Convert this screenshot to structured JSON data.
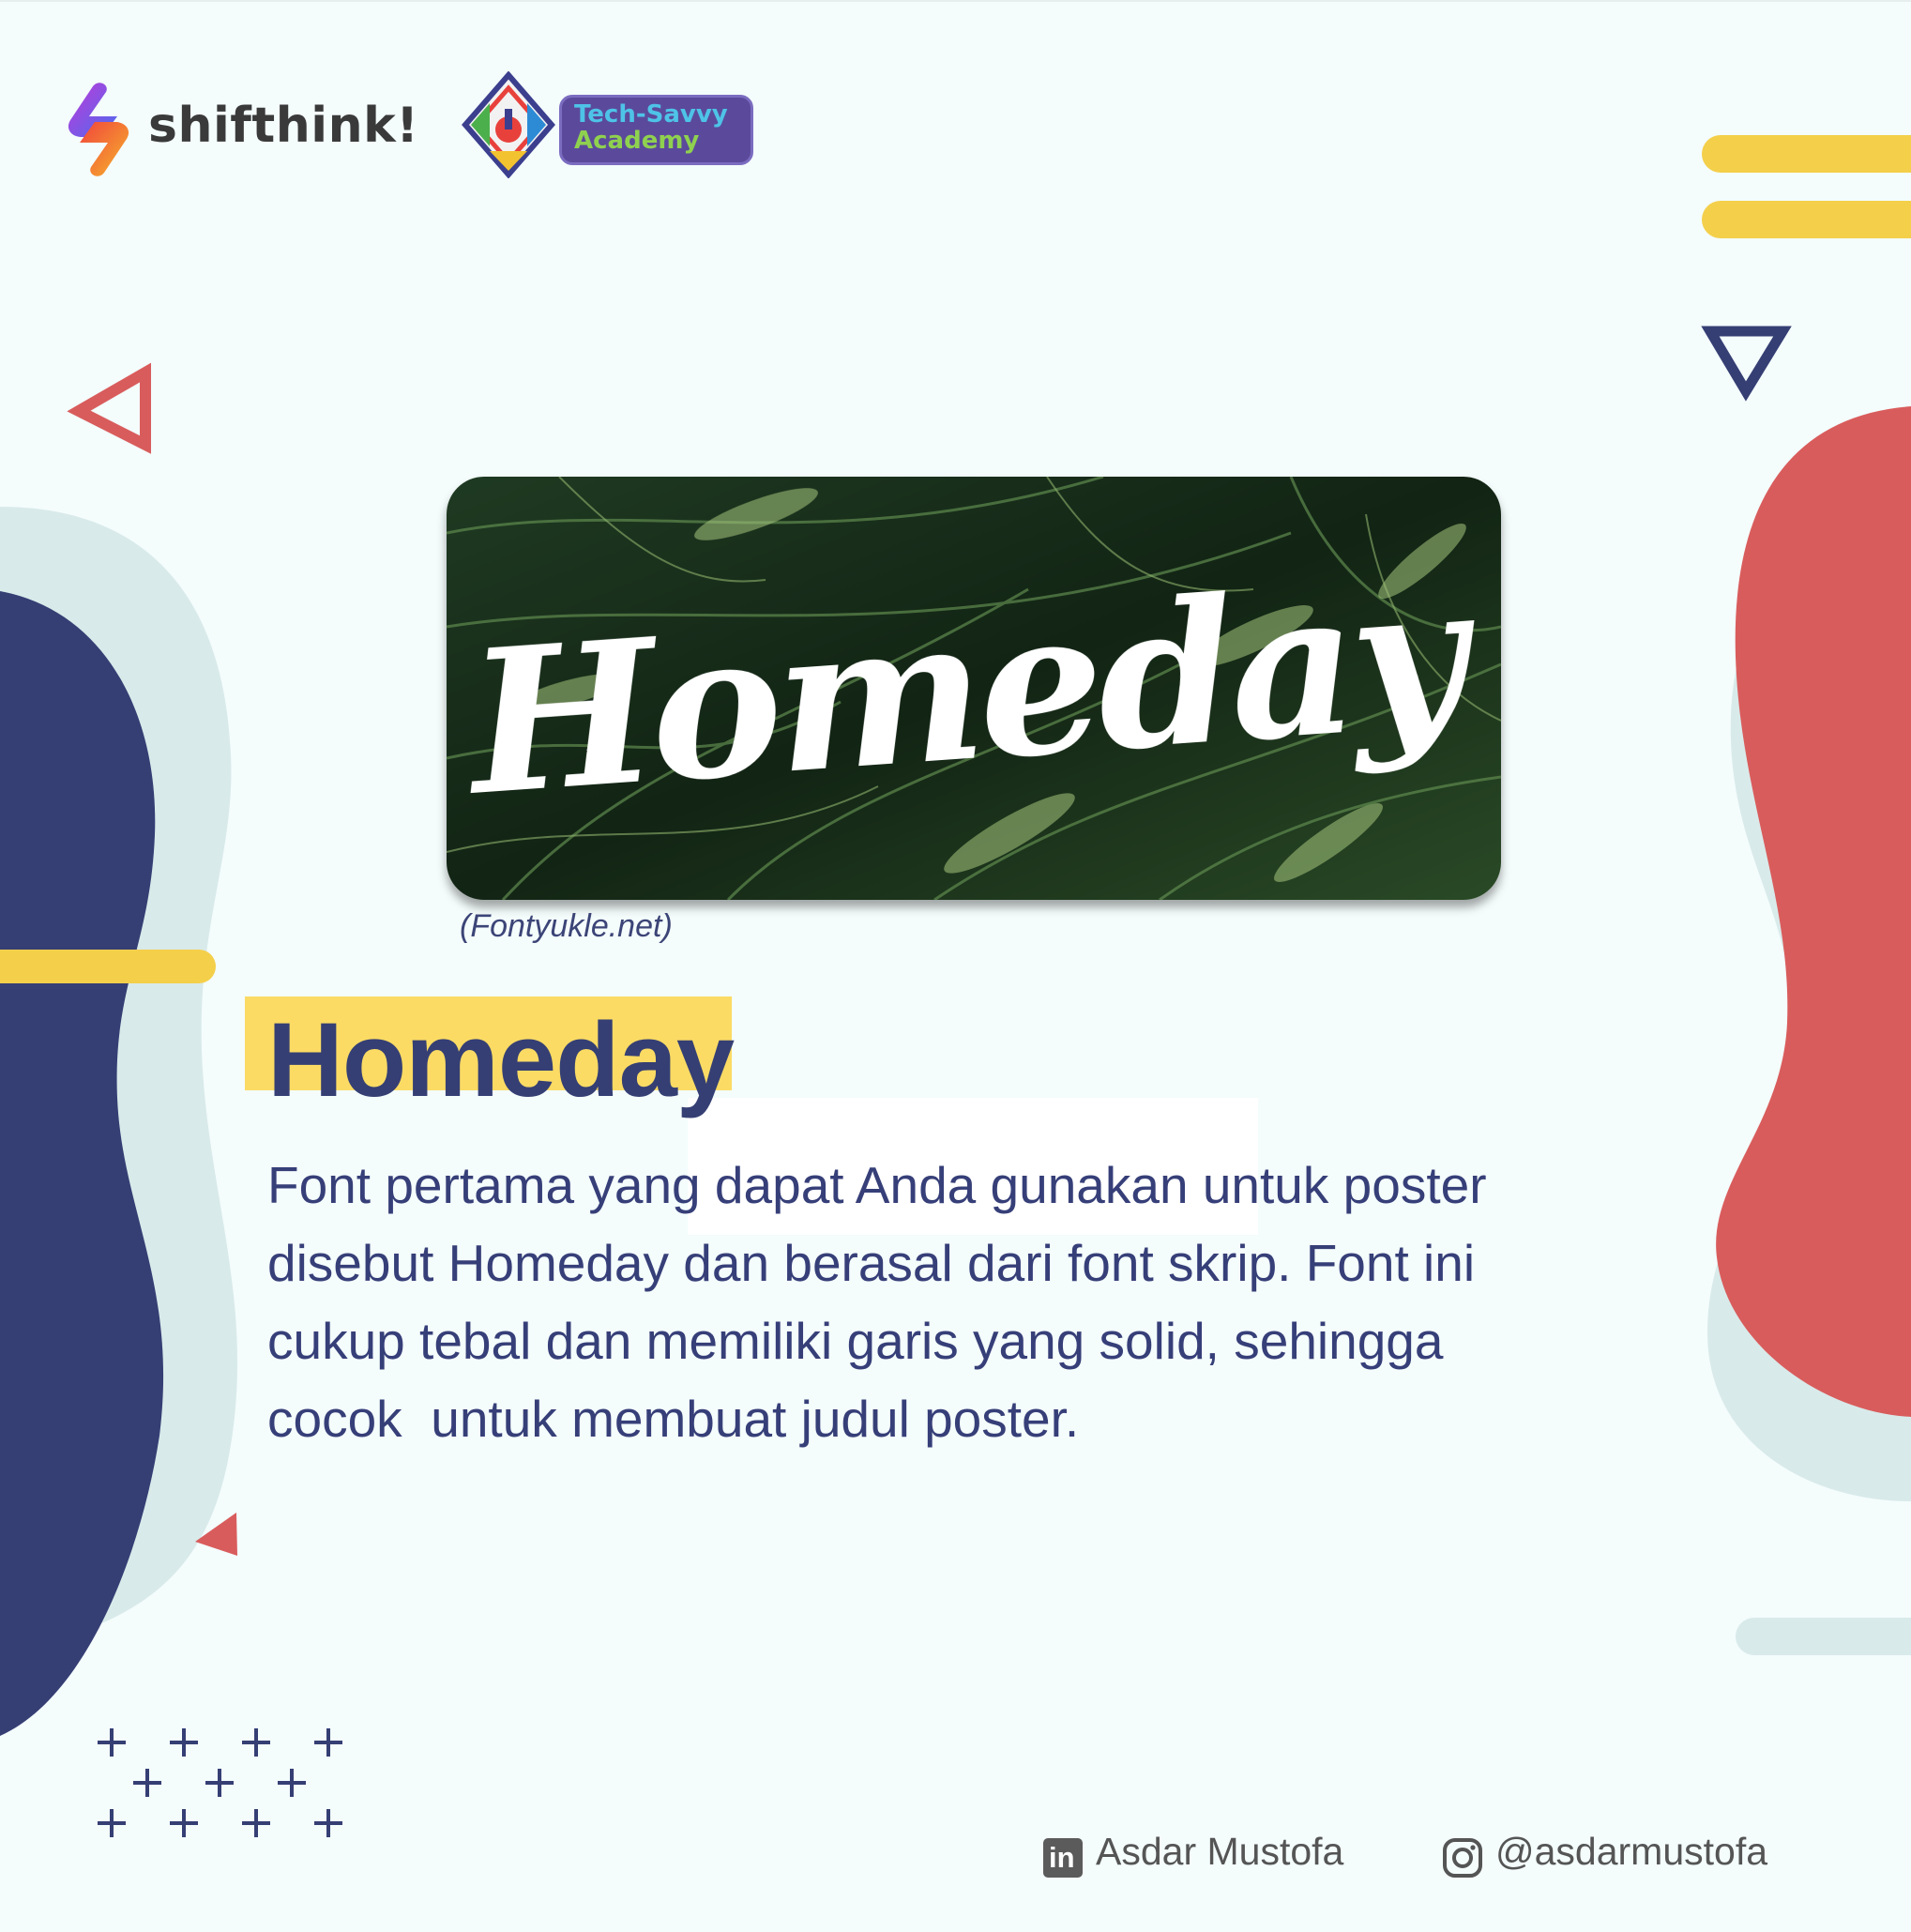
{
  "brand": {
    "name": "shifthink!"
  },
  "partner": {
    "line1": "Tech-Savvy",
    "line2": "Academy"
  },
  "hero": {
    "script_text": "Homeday",
    "source": "(Fontyukle.net)"
  },
  "heading": "Homeday",
  "body_lines": [
    "Font pertama yang dapat Anda gunakan untuk poster",
    "disebut Homeday dan berasal dari font skrip. Font ini",
    "cukup tebal dan memiliki garis yang solid, sehingga",
    "cocok  untuk membuat judul poster."
  ],
  "footer": {
    "linkedin_name": "Asdar Mustofa",
    "instagram_handle": "@asdarmustofa"
  },
  "colors": {
    "navy": "#363f78",
    "red": "#d95c5c",
    "yellow": "#f4cf4a",
    "mint": "#d9eaea",
    "background": "#f4fcfc"
  },
  "icons": [
    "shifthink-logo-icon",
    "tech-savvy-emblem-icon",
    "linkedin-icon",
    "instagram-icon"
  ]
}
